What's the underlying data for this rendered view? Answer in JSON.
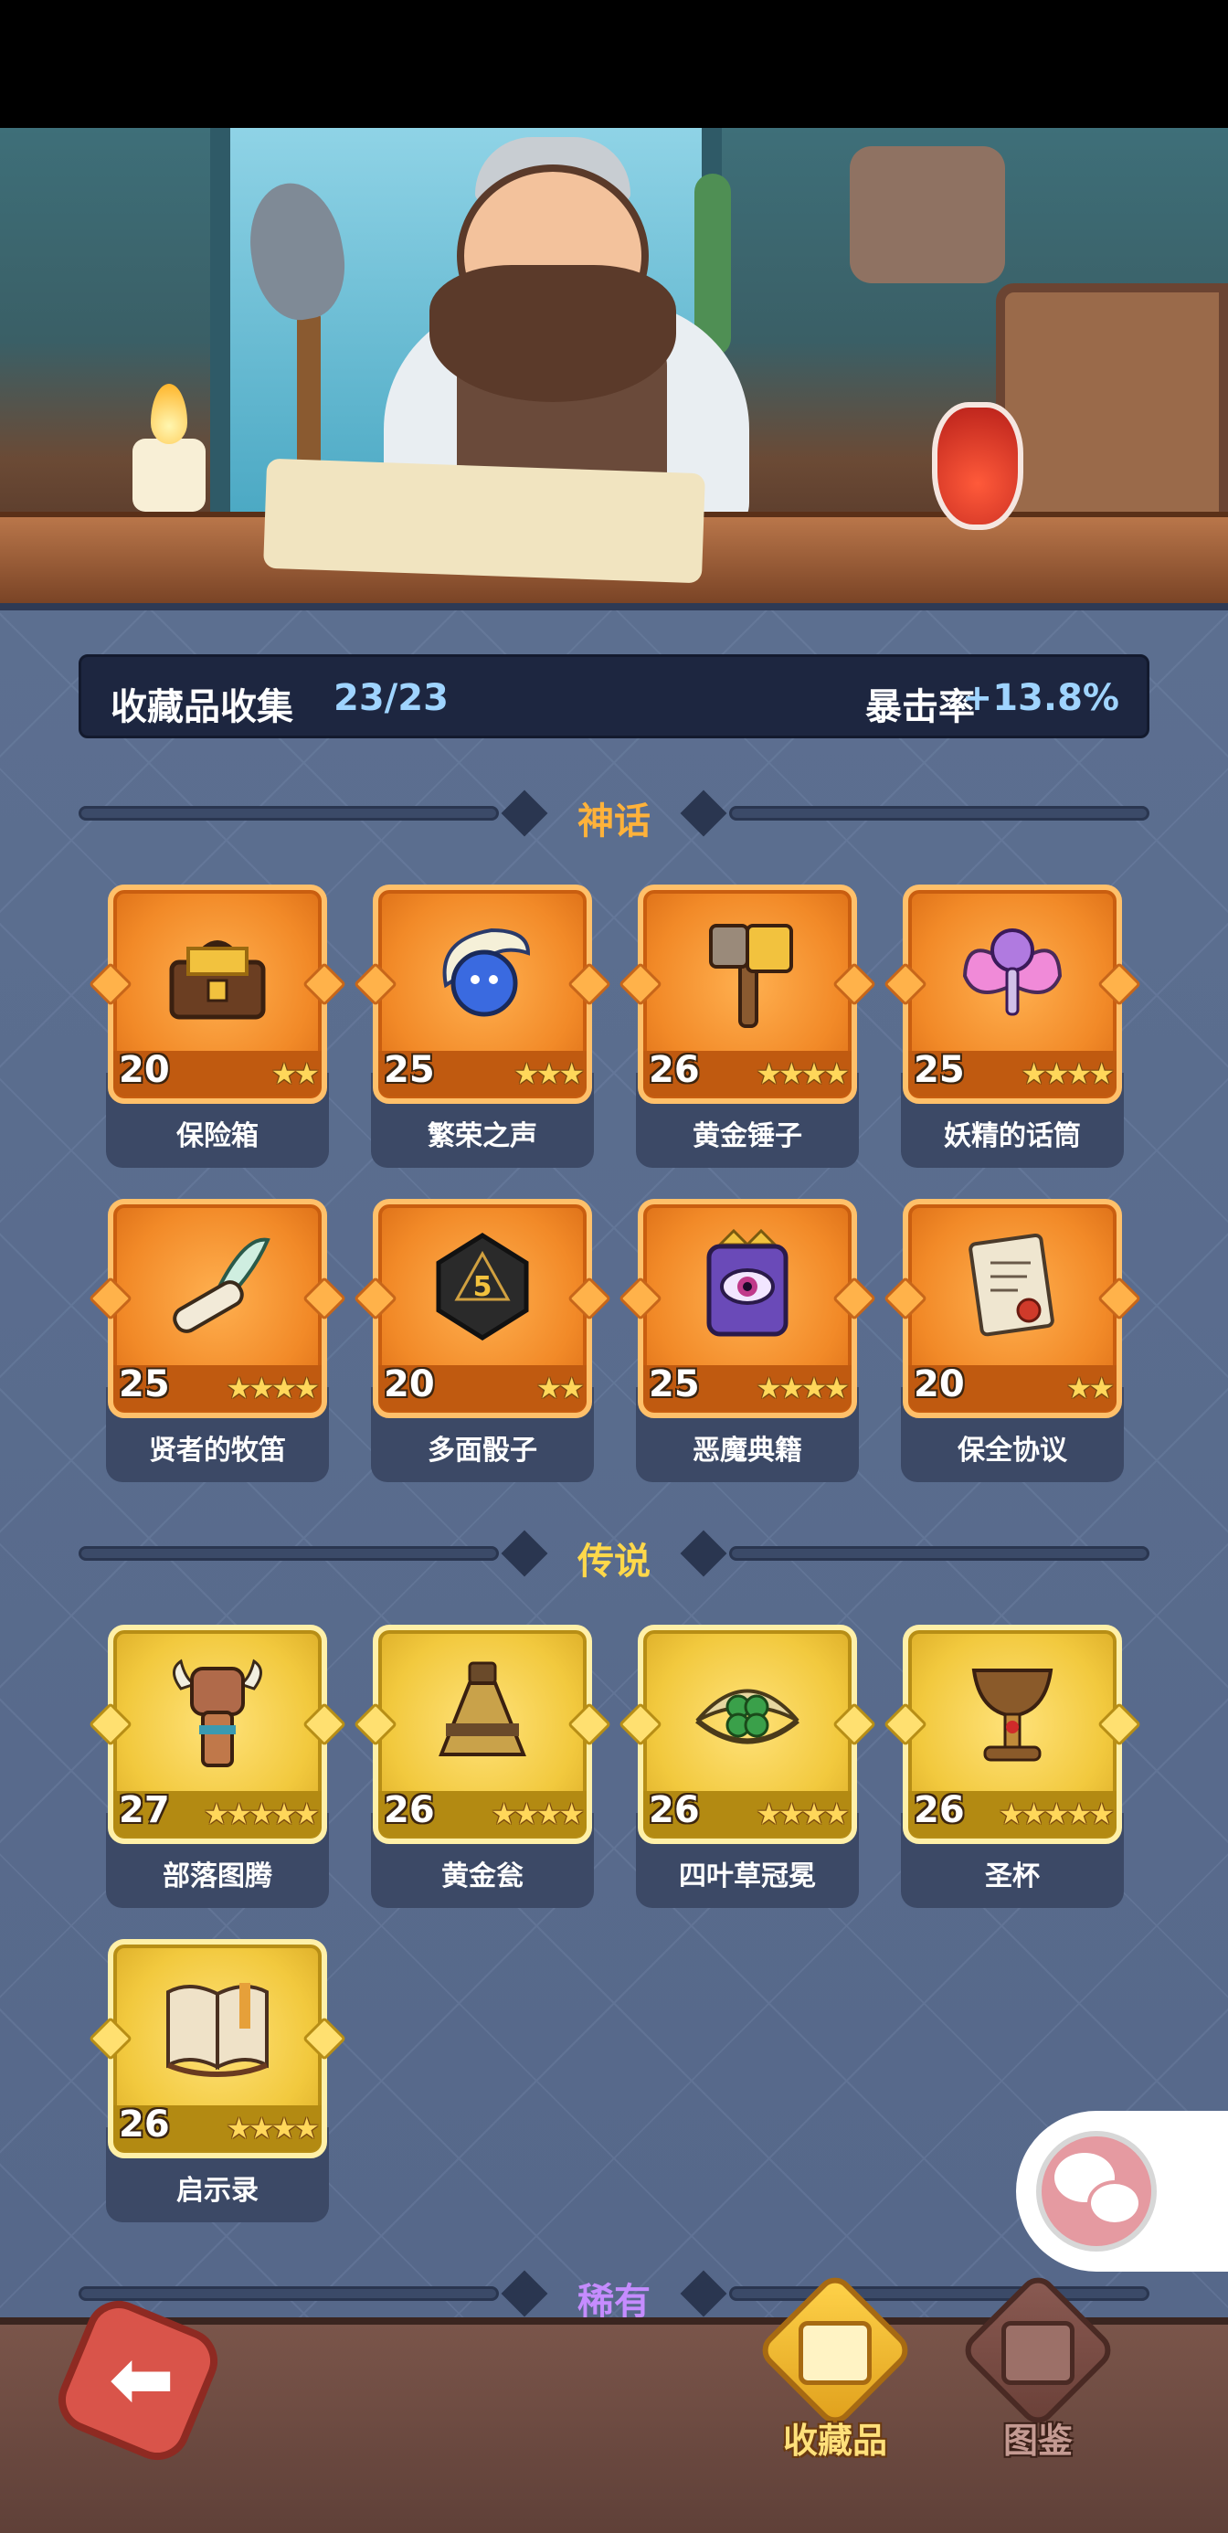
{
  "summary": {
    "label": "收藏品收集",
    "count": "23/23",
    "crit_label": "暴击率",
    "crit_value": "+13.8%"
  },
  "sections": {
    "mythic": "神话",
    "legend": "传说",
    "rare": "稀有"
  },
  "mythic_items": [
    {
      "name": "保险箱",
      "level": "20",
      "stars": "★★",
      "icon": "treasure-chest-icon"
    },
    {
      "name": "繁荣之声",
      "level": "25",
      "stars": "★★★",
      "icon": "blue-spirit-icon"
    },
    {
      "name": "黄金锤子",
      "level": "26",
      "stars": "★★★★",
      "icon": "golden-hammer-icon"
    },
    {
      "name": "妖精的话筒",
      "level": "25",
      "stars": "★★★★",
      "icon": "fairy-microphone-icon"
    },
    {
      "name": "贤者的牧笛",
      "level": "25",
      "stars": "★★★★",
      "icon": "feather-flute-icon"
    },
    {
      "name": "多面骰子",
      "level": "20",
      "stars": "★★",
      "icon": "polyhedral-dice-icon"
    },
    {
      "name": "恶魔典籍",
      "level": "25",
      "stars": "★★★★",
      "icon": "demon-eye-book-icon"
    },
    {
      "name": "保全协议",
      "level": "20",
      "stars": "★★",
      "icon": "contract-scroll-icon"
    }
  ],
  "legend_items": [
    {
      "name": "部落图腾",
      "level": "27",
      "stars": "★★★★★",
      "icon": "tribal-totem-icon"
    },
    {
      "name": "黄金瓮",
      "level": "26",
      "stars": "★★★★",
      "icon": "golden-urn-icon"
    },
    {
      "name": "四叶草冠冕",
      "level": "26",
      "stars": "★★★★",
      "icon": "clover-crown-icon"
    },
    {
      "name": "圣杯",
      "level": "26",
      "stars": "★★★★★",
      "icon": "holy-grail-icon"
    },
    {
      "name": "启示录",
      "level": "26",
      "stars": "★★★★",
      "icon": "open-book-icon"
    }
  ],
  "nav": {
    "collection_label": "收藏品",
    "codex_label": "图鉴"
  },
  "colors": {
    "mythic_title": "#ffb23a",
    "legend_title": "#ffd84a",
    "rare_title": "#c58cff",
    "panel": "#5c6f90"
  }
}
